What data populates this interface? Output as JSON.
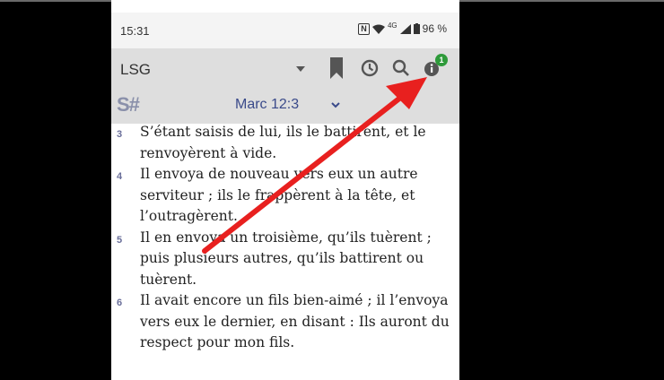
{
  "status": {
    "time": "15:31",
    "signal": "4G",
    "battery": "96 %"
  },
  "toolbar": {
    "version": "LSG",
    "logo": "S#",
    "reference": "Marc 12:3",
    "badge_count": "1"
  },
  "verses": [
    {
      "num": "3",
      "text": "S’étant saisis de lui, ils le battirent, et le renvoyèrent à vide."
    },
    {
      "num": "4",
      "text": "Il envoya de nouveau vers eux un autre serviteur ; ils le frappèrent à la tête, et l’outragèrent."
    },
    {
      "num": "5",
      "text": "Il en envoya un troisième, qu’ils tuèrent ; puis plusieurs autres, qu’ils battirent ou tuèrent."
    },
    {
      "num": "6",
      "text": "Il avait encore un fils bien-aimé ; il l’envoya vers eux le dernier, en disant : Ils auront du respect pour mon fils."
    }
  ],
  "colors": {
    "arrow": "#e8201f",
    "badge": "#2e9a3a",
    "reference": "#3a4a8a"
  }
}
